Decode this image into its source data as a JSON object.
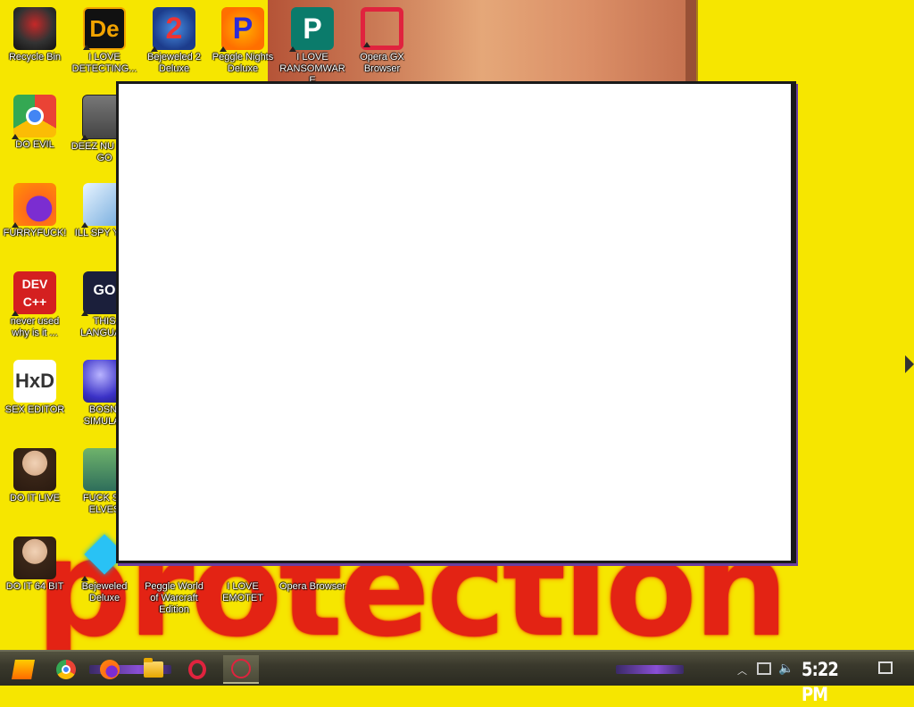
{
  "desktop": {
    "icons": [
      {
        "label": "Recycle Bin",
        "icon": "recycle-bin-icon"
      },
      {
        "label": "I LOVE DETECTING...",
        "icon": "detect-it-easy-icon"
      },
      {
        "label": "Bejeweled 2 Deluxe",
        "icon": "bejeweled-2-icon"
      },
      {
        "label": "Peggle Nights Deluxe",
        "icon": "peggle-nights-icon"
      },
      {
        "label": "I LOVE RANSOMWARE",
        "icon": "publisher-icon"
      },
      {
        "label": "Opera GX Browser",
        "icon": "opera-gx-icon"
      },
      {
        "label": "DO EVIL",
        "icon": "chrome-icon"
      },
      {
        "label": "DEEZ NU HAH GO",
        "icon": "stacked-windows-icon"
      },
      {
        "label": "FURRYFUCK!",
        "icon": "firefox-icon"
      },
      {
        "label": "ILL SPY YOU",
        "icon": "spy-tool-icon"
      },
      {
        "label": "never used why is it ...",
        "icon": "dev-cpp-icon"
      },
      {
        "label": "THIS LANGUAG",
        "icon": "goland-icon"
      },
      {
        "label": "SEX EDITOR",
        "icon": "hxd-icon"
      },
      {
        "label": "BOSNI SIMULAT",
        "icon": "bosnia-sim-icon"
      },
      {
        "label": "DO IT LIVE",
        "icon": "portrait-icon"
      },
      {
        "label": "FUCK SC ELVES",
        "icon": "elves-icon"
      },
      {
        "label": "DO IT 64 BIT",
        "icon": "portrait-64-icon"
      },
      {
        "label": "Bejeweled Deluxe",
        "icon": "bejeweled-icon"
      },
      {
        "label": "Peggle World of Warcraft Edition",
        "icon": "peggle-wow-icon"
      },
      {
        "label": "I LOVE EMOTET",
        "icon": "emotet-icon"
      },
      {
        "label": "Opera Browser",
        "icon": "opera-icon"
      }
    ],
    "wallpaper_text": "protection"
  },
  "taskbar": {
    "clock": "5:22 PM",
    "apps": [
      "start",
      "chrome",
      "firefox",
      "file-explorer",
      "opera",
      "opera-gx"
    ]
  }
}
